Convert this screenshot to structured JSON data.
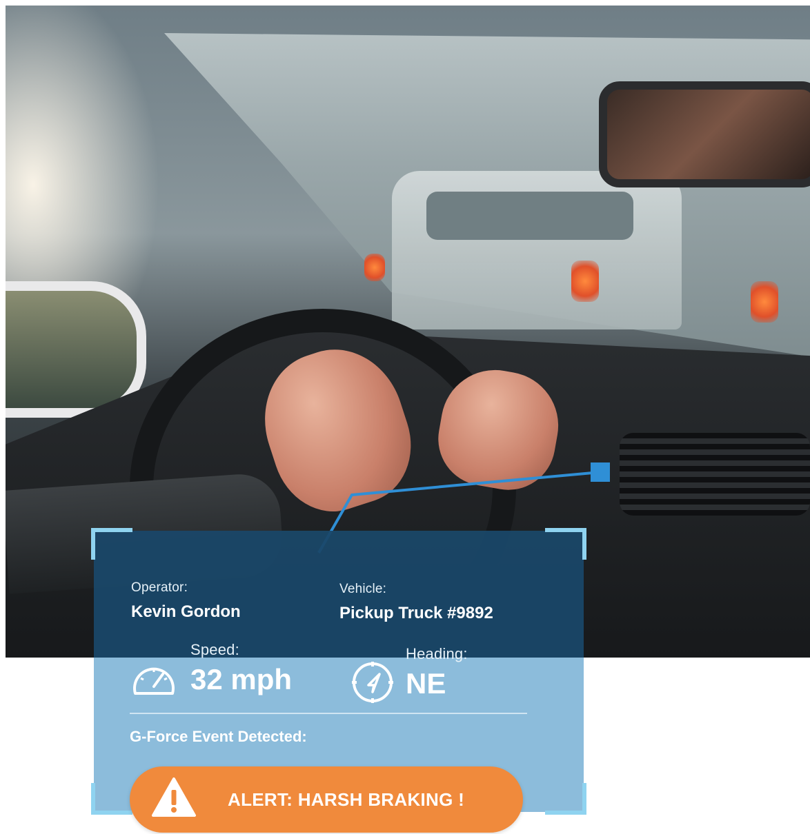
{
  "panel": {
    "operator_label": "Operator:",
    "operator_value": "Kevin Gordon",
    "vehicle_label": "Vehicle:",
    "vehicle_value": "Pickup Truck #9892",
    "speed_label": "Speed:",
    "speed_value": "32 mph",
    "heading_label": "Heading:",
    "heading_value": "NE",
    "event_label": "G-Force Event Detected:",
    "alert_text": "ALERT: HARSH BRAKING !"
  },
  "icons": {
    "speed": "speedometer-icon",
    "heading": "compass-icon",
    "alert": "warning-triangle-icon"
  },
  "colors": {
    "panel_dark": "#0c3454",
    "panel_light": "#60a2cd",
    "accent": "#2f8fd6",
    "corner_brackets": "#8fd3f0",
    "alert_bg": "#f08a3c"
  }
}
